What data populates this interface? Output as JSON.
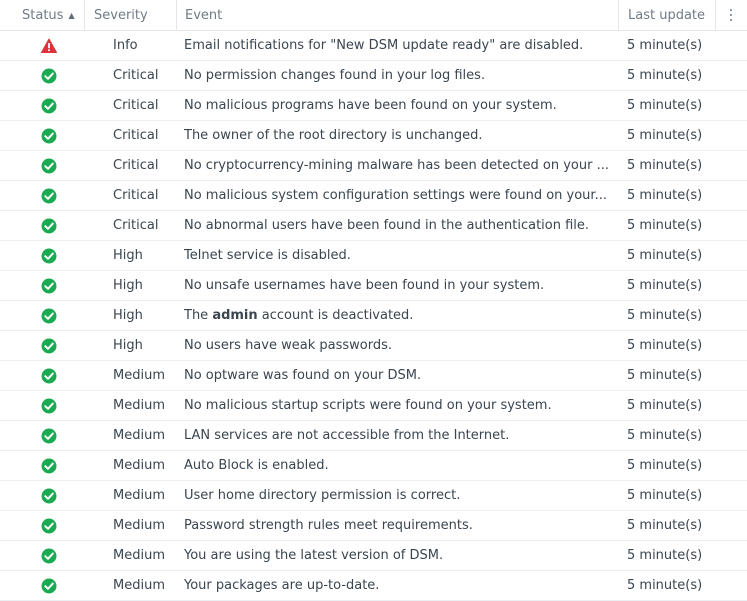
{
  "columns": {
    "status": "Status",
    "severity": "Severity",
    "event": "Event",
    "last_update": "Last update"
  },
  "colors": {
    "ok": "#1aaa52",
    "warning": "#e0303a"
  },
  "rows": [
    {
      "status": "warning-icon",
      "severity": "Info",
      "event": "Email notifications for \"New DSM update ready\" are disabled.",
      "last_update": "5 minute(s)"
    },
    {
      "status": "check-icon",
      "severity": "Critical",
      "event": "No permission changes found in your log files.",
      "last_update": "5 minute(s)"
    },
    {
      "status": "check-icon",
      "severity": "Critical",
      "event": "No malicious programs have been found on your system.",
      "last_update": "5 minute(s)"
    },
    {
      "status": "check-icon",
      "severity": "Critical",
      "event": "The owner of the root directory is unchanged.",
      "last_update": "5 minute(s)"
    },
    {
      "status": "check-icon",
      "severity": "Critical",
      "event": "No cryptocurrency-mining malware has been detected on your ...",
      "last_update": "5 minute(s)"
    },
    {
      "status": "check-icon",
      "severity": "Critical",
      "event": "No malicious system configuration settings were found on your...",
      "last_update": "5 minute(s)"
    },
    {
      "status": "check-icon",
      "severity": "Critical",
      "event": "No abnormal users have been found in the authentication file.",
      "last_update": "5 minute(s)"
    },
    {
      "status": "check-icon",
      "severity": "High",
      "event": "Telnet service is disabled.",
      "last_update": "5 minute(s)"
    },
    {
      "status": "check-icon",
      "severity": "High",
      "event": "No unsafe usernames have been found in your system.",
      "last_update": "5 minute(s)"
    },
    {
      "status": "check-icon",
      "severity": "High",
      "event_pre": "The ",
      "event_bold": "admin",
      "event_post": " account is deactivated.",
      "last_update": "5 minute(s)"
    },
    {
      "status": "check-icon",
      "severity": "High",
      "event": "No users have weak passwords.",
      "last_update": "5 minute(s)"
    },
    {
      "status": "check-icon",
      "severity": "Medium",
      "event": "No optware was found on your DSM.",
      "last_update": "5 minute(s)"
    },
    {
      "status": "check-icon",
      "severity": "Medium",
      "event": "No malicious startup scripts were found on your system.",
      "last_update": "5 minute(s)"
    },
    {
      "status": "check-icon",
      "severity": "Medium",
      "event": "LAN services are not accessible from the Internet.",
      "last_update": "5 minute(s)"
    },
    {
      "status": "check-icon",
      "severity": "Medium",
      "event": "Auto Block is enabled.",
      "last_update": "5 minute(s)"
    },
    {
      "status": "check-icon",
      "severity": "Medium",
      "event": "User home directory permission is correct.",
      "last_update": "5 minute(s)"
    },
    {
      "status": "check-icon",
      "severity": "Medium",
      "event": "Password strength rules meet requirements.",
      "last_update": "5 minute(s)"
    },
    {
      "status": "check-icon",
      "severity": "Medium",
      "event": "You are using the latest version of DSM.",
      "last_update": "5 minute(s)"
    },
    {
      "status": "check-icon",
      "severity": "Medium",
      "event": "Your packages are up-to-date.",
      "last_update": "5 minute(s)"
    }
  ]
}
